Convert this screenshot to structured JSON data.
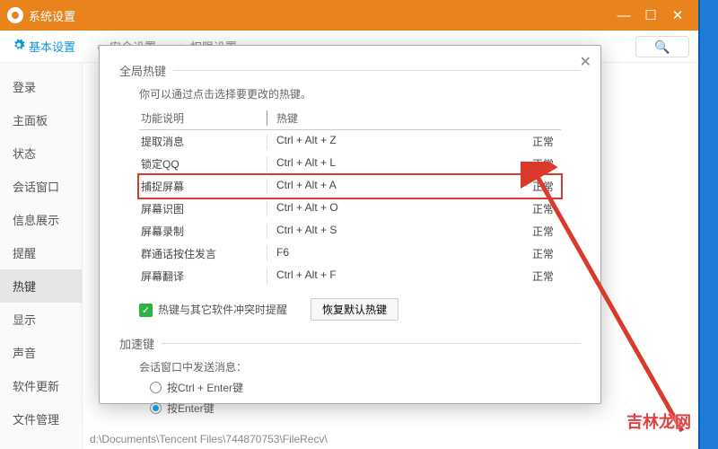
{
  "titlebar": {
    "title": "系统设置"
  },
  "tabs": {
    "t0": "基本设置",
    "t1": "安全设置",
    "t2": "权限设置"
  },
  "sidebar": {
    "s0": "登录",
    "s1": "主面板",
    "s2": "状态",
    "s3": "会话窗口",
    "s4": "信息展示",
    "s5": "提醒",
    "s6": "热键",
    "s7": "显示",
    "s8": "声音",
    "s9": "软件更新",
    "s10": "文件管理"
  },
  "modal": {
    "global_section": "全局热键",
    "hint": "你可以通过点击选择要更改的热键。",
    "hdr_func": "功能说明",
    "hdr_key": "热键",
    "rows": [
      {
        "f": "提取消息",
        "k": "Ctrl + Alt + Z",
        "s": "正常"
      },
      {
        "f": "锁定QQ",
        "k": "Ctrl + Alt + L",
        "s": "正常"
      },
      {
        "f": "捕捉屏幕",
        "k": "Ctrl + Alt + A",
        "s": "正常"
      },
      {
        "f": "屏幕识图",
        "k": "Ctrl + Alt + O",
        "s": "正常"
      },
      {
        "f": "屏幕录制",
        "k": "Ctrl + Alt + S",
        "s": "正常"
      },
      {
        "f": "群通话按住发言",
        "k": "F6",
        "s": "正常"
      },
      {
        "f": "屏幕翻译",
        "k": "Ctrl + Alt + F",
        "s": "正常"
      }
    ],
    "conflict_label": "热键与其它软件冲突时提醒",
    "restore": "恢复默认热键",
    "accel_section": "加速键",
    "send_label": "会话窗口中发送消息：",
    "opt1": "按Ctrl + Enter键",
    "opt2": "按Enter键"
  },
  "footer_path": "d:\\Documents\\Tencent Files\\744870753\\FileRecv\\",
  "watermark": "吉林龙网"
}
